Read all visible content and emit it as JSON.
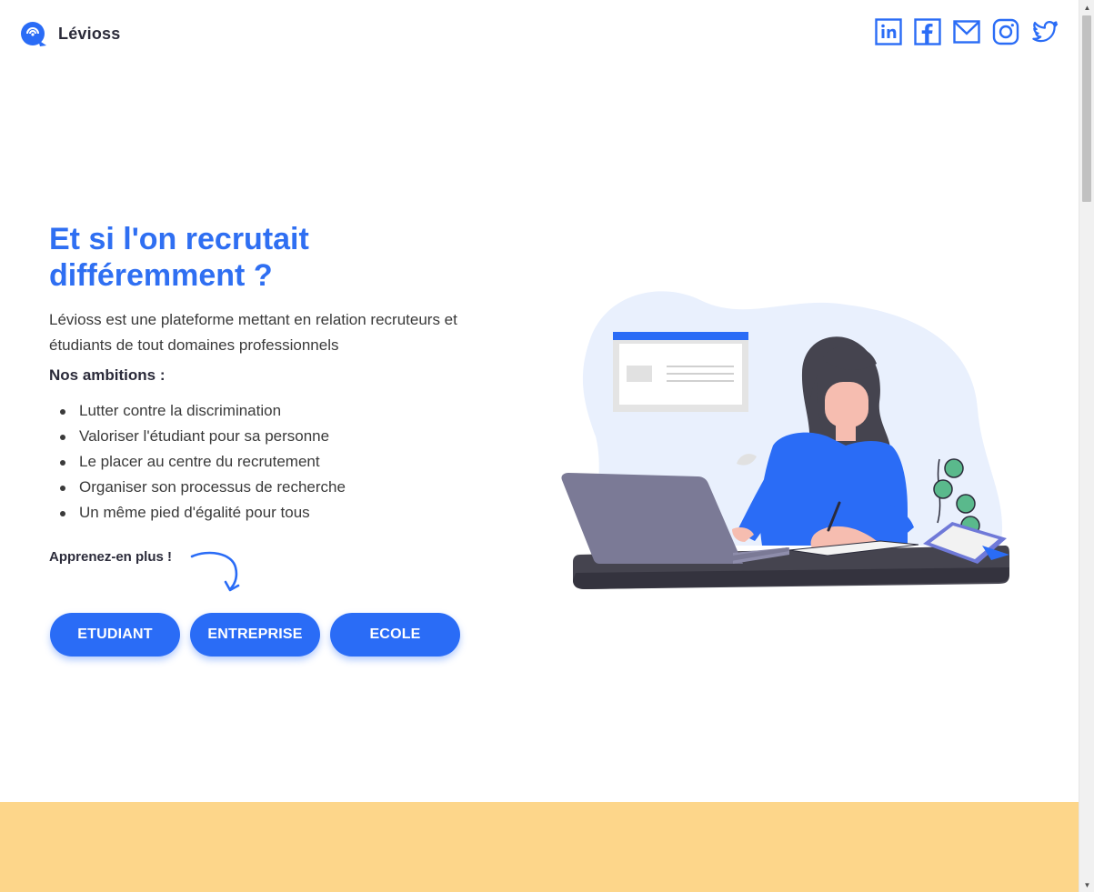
{
  "brand": {
    "name": "Lévioss",
    "logo_icon": "levioss-logo-icon"
  },
  "socials": [
    {
      "name": "linkedin-icon"
    },
    {
      "name": "facebook-icon"
    },
    {
      "name": "mail-icon"
    },
    {
      "name": "instagram-icon"
    },
    {
      "name": "twitter-icon"
    }
  ],
  "hero": {
    "title": "Et si l'on recrutait différemment ?",
    "description": "Lévioss est une plateforme mettant en relation recruteurs et étudiants de tout domaines professionnels",
    "ambitions_title": "Nos ambitions :",
    "ambitions": [
      "Lutter contre la discrimination",
      "Valoriser l'étudiant pour sa personne",
      "Le placer au centre du recrutement",
      "Organiser son processus de recherche",
      "Un même pied d'égalité pour tous"
    ],
    "learn_more": "Apprenez-en plus !"
  },
  "buttons": {
    "student": "ETUDIANT",
    "company": "ENTREPRISE",
    "school": "ECOLE"
  },
  "colors": {
    "accent": "#2a6cf6",
    "title": "#2f6ff2",
    "band": "#fdd68a",
    "blob": "#e9f0fd"
  }
}
